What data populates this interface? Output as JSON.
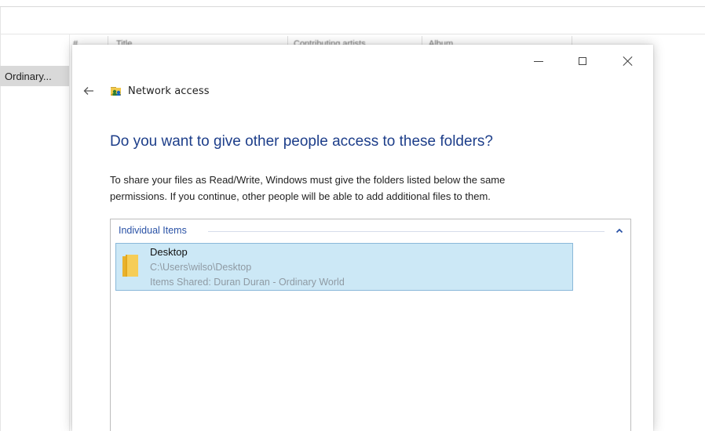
{
  "background_window": {
    "columns": [
      "#",
      "Title",
      "Contributing artists",
      "Album"
    ],
    "selected_item_label": "Ordinary..."
  },
  "dialog": {
    "nav_title": "Network access",
    "heading": "Do you want to give other people access to these folders?",
    "body_line_1": "To share your files as Read/Write, Windows must give the folders listed below the same",
    "body_line_2": "permissions.  If you continue, other people will be able to add additional files to them.",
    "group_header": "Individual Items",
    "item": {
      "name": "Desktop",
      "path": "C:\\Users\\wilso\\Desktop",
      "shared": "Items Shared: Duran Duran - Ordinary World"
    },
    "icons": {
      "back": "back-arrow-icon",
      "network": "network-share-icon",
      "folder": "folder-icon",
      "collapse": "chevron-up-icon",
      "minimize": "minimize-icon",
      "maximize": "maximize-icon",
      "close": "close-icon"
    },
    "colors": {
      "heading": "#1d3e8a",
      "selection_fill": "#cce8f6",
      "selection_border": "#8ab8d9",
      "group_header": "#2a52a6"
    }
  }
}
